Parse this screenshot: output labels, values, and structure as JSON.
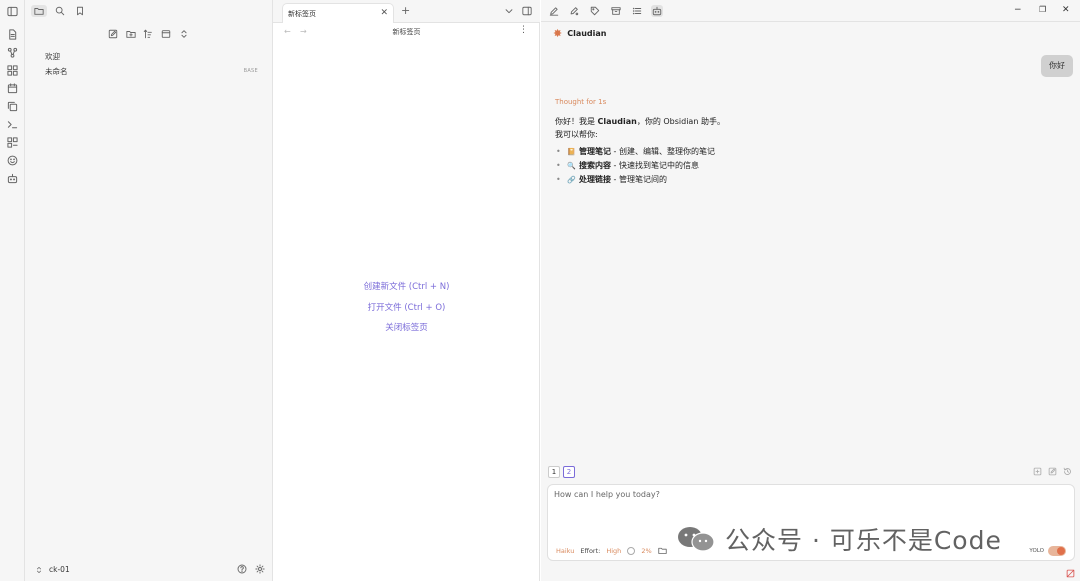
{
  "tab": {
    "label": "新标签页"
  },
  "view": {
    "title": "新标签页"
  },
  "tree": {
    "items": [
      "欢迎",
      "未命名"
    ],
    "badge": "BASE"
  },
  "vault": {
    "name": "ck-01"
  },
  "empty_actions": [
    "创建新文件 (Ctrl + N)",
    "打开文件 (Ctrl + O)",
    "关闭标签页"
  ],
  "chat": {
    "title": "Claudian",
    "user_message": "你好",
    "thought": "Thought for 1s",
    "reply_pre": "你好！我是 ",
    "reply_name": "Claudian",
    "reply_post": "，你的 Obsidian 助手。",
    "reply_intro": "我可以帮你:",
    "items": [
      {
        "bold": "管理笔记",
        "text": " - 创建、编辑、整理你的笔记",
        "icon": "notebook-emoji"
      },
      {
        "bold": "搜索内容",
        "text": " - 快速找到笔记中的信息",
        "icon": "magnifier-emoji"
      },
      {
        "bold": "处理链接",
        "text": " - 管理笔记间的",
        "icon": "link-emoji"
      }
    ],
    "conversation_tabs": [
      "1",
      "2"
    ],
    "input_placeholder": "How can I help you today?",
    "model": "Haiku",
    "effort_label": "Effort:",
    "effort_value": "High",
    "context_pct": "2%",
    "yolo_label": "YOLO"
  },
  "watermark": {
    "text": "公众号 · 可乐不是Code"
  },
  "colors": {
    "accent": "#7b6cd9",
    "claude_orange": "#d9774b",
    "thought": "#d98a5e"
  }
}
